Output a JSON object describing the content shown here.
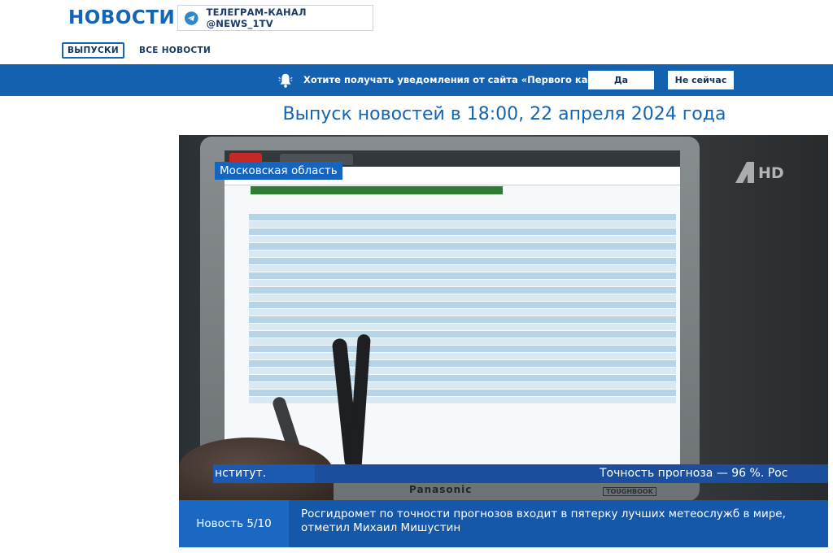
{
  "header": {
    "logo": "НОВОСТИ",
    "telegram_label": "ТЕЛЕГРАМ-КАНАЛ @NEWS_1TV",
    "telegram_icon": "telegram-icon"
  },
  "subnav": {
    "tabs": [
      {
        "label": "ВЫПУСКИ",
        "active": true
      },
      {
        "label": "ВСЕ НОВОСТИ",
        "active": false
      }
    ]
  },
  "notification": {
    "icon": "bell-icon",
    "text": "Хотите получать уведомления от сайта «Первого канала»?",
    "yes_label": "Да",
    "no_label": "Не сейчас"
  },
  "page_title": "Выпуск новостей в 18:00, 22 апреля 2024 года",
  "video": {
    "region_label": "Московская область",
    "channel_logo": "HD",
    "ticker_left": "нститут.",
    "ticker_right": "Точность прогноза — 96 %. Рос",
    "laptop_brand": "Panasonic",
    "laptop_model": "TOUGHBOOK"
  },
  "caption": {
    "number": "Новость 5/10",
    "text": "Росгидромет по точности прогнозов входит в пятерку лучших метеослужб в мире, отметил Михаил Мишустин"
  },
  "colors": {
    "brand_blue": "#1565b5",
    "notify_bar": "#1462af",
    "caption_blue": "#1557a8"
  }
}
